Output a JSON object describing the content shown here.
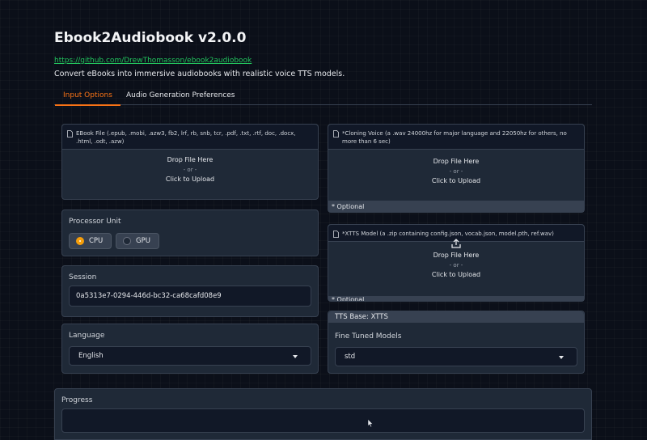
{
  "header": {
    "title": "Ebook2Audiobook v2.0.0",
    "link": "https://github.com/DrewThomasson/ebook2audiobook",
    "description": "Convert eBooks into immersive audiobooks with realistic voice TTS models."
  },
  "tabs": [
    {
      "label": "Input Options",
      "active": true
    },
    {
      "label": "Audio Generation Preferences",
      "active": false
    }
  ],
  "ebook_upload": {
    "label": "EBook File (.epub, .mobi, .azw3, fb2, lrf, rb, snb, tcr, .pdf, .txt, .rtf, doc, .docx, .html, .odt, .azw)",
    "drop_text": "Drop File Here",
    "or_text": "- or -",
    "click_text": "Click to Upload"
  },
  "voice_upload": {
    "label": "*Cloning Voice (a .wav 24000hz for major language and 22050hz for others, no more than 6 sec)",
    "drop_text": "Drop File Here",
    "or_text": "- or -",
    "click_text": "Click to Upload",
    "optional": "* Optional"
  },
  "model_upload": {
    "label": "*XTTS Model (a .zip containing config.json, vocab.json, model.pth, ref.wav)",
    "drop_text": "Drop File Here",
    "or_text": "- or -",
    "click_text": "Click to Upload",
    "optional": "* Optional"
  },
  "processor": {
    "label": "Processor Unit",
    "options": [
      {
        "label": "CPU",
        "selected": true
      },
      {
        "label": "GPU",
        "selected": false
      }
    ]
  },
  "session": {
    "label": "Session",
    "value": "0a5313e7-0294-446d-bc32-ca68cafd08e9"
  },
  "language": {
    "label": "Language",
    "value": "English"
  },
  "tts": {
    "header": "TTS Base:  XTTS",
    "fine_tuned_label": "Fine Tuned Models",
    "fine_tuned_value": "std"
  },
  "progress": {
    "label": "Progress"
  },
  "colors": {
    "accent": "#f97316",
    "link": "#22c55e",
    "radio_selected": "#f59e0b",
    "background": "#0b0f19",
    "panel": "#1f2937"
  },
  "icons": [
    "file-icon",
    "upload-icon",
    "chevron-down-icon",
    "mouse-cursor-icon"
  ]
}
